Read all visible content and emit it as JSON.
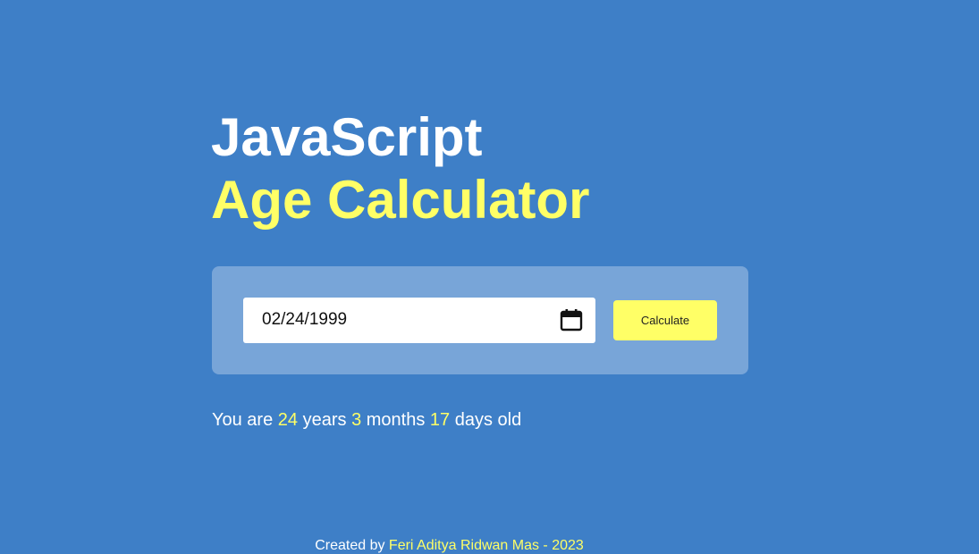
{
  "header": {
    "title_line1": "JavaScript",
    "title_line2": "Age Calculator"
  },
  "form": {
    "date_value": "02/24/1999",
    "calculate_label": "Calculate"
  },
  "result": {
    "prefix": "You are",
    "years": "24",
    "years_label": "years",
    "months": "3",
    "months_label": "months",
    "days": "17",
    "days_label": "days old"
  },
  "footer": {
    "created_by": "Created by",
    "author": "Feri Aditya Ridwan Mas - 2023"
  },
  "colors": {
    "background": "#3e7fc7",
    "panel": "#78a5d8",
    "accent": "#ffff66",
    "text": "#ffffff"
  },
  "icons": {
    "date_picker": "calendar-icon"
  }
}
